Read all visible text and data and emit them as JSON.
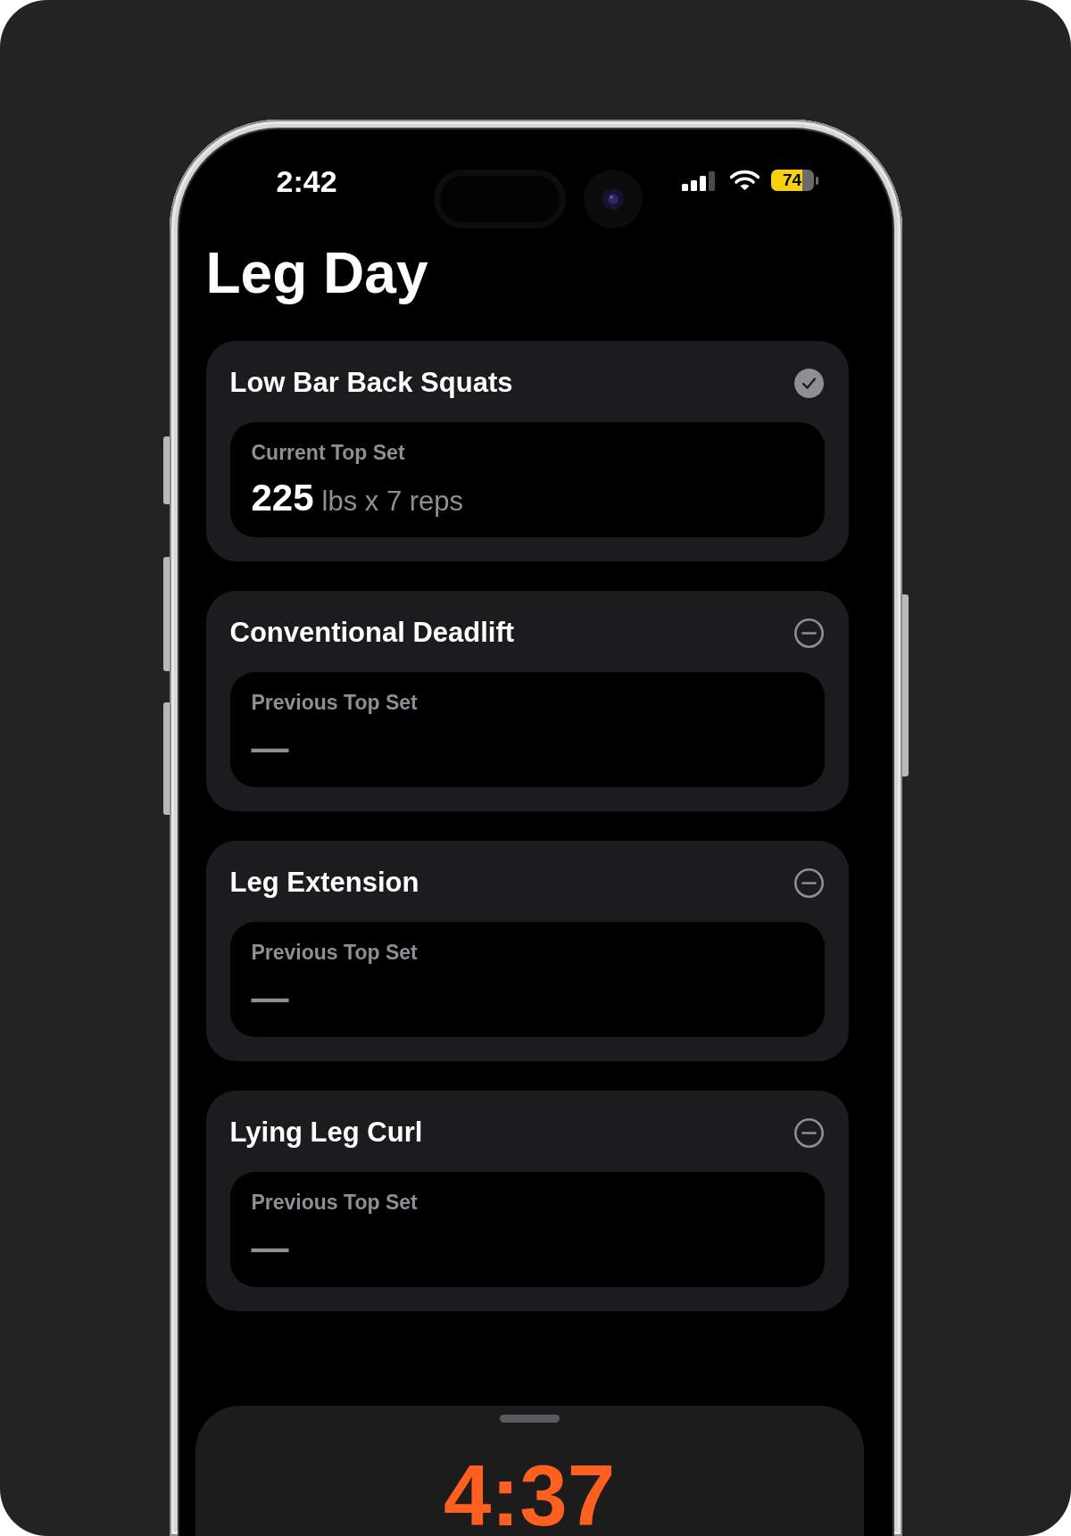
{
  "status_bar": {
    "time": "2:42",
    "battery": "74"
  },
  "title": "Leg Day",
  "exercises": [
    {
      "name": "Low Bar Back Squats",
      "completed": true,
      "top_set": {
        "kind": "recorded",
        "label": "Current Top Set",
        "value": "225",
        "detail": "lbs x 7 reps"
      }
    },
    {
      "name": "Conventional Deadlift",
      "completed": false,
      "top_set": {
        "kind": "empty",
        "label": "Previous Top Set",
        "value": "—"
      }
    },
    {
      "name": "Leg Extension",
      "completed": false,
      "top_set": {
        "kind": "empty",
        "label": "Previous Top Set",
        "value": "—"
      }
    },
    {
      "name": "Lying Leg Curl",
      "completed": false,
      "top_set": {
        "kind": "empty",
        "label": "Previous Top Set",
        "value": "—"
      }
    }
  ],
  "timer_sheet": {
    "time": "4:37"
  }
}
